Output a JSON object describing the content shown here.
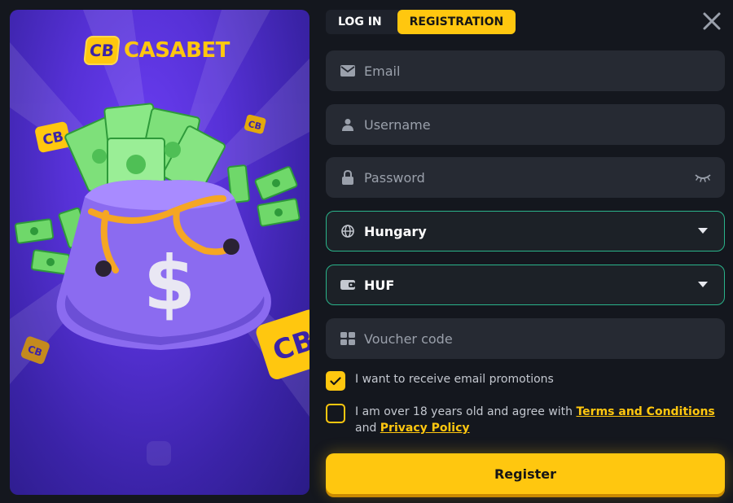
{
  "brand": {
    "logo_badge": "CB",
    "name_part1": "CASA",
    "name_part2": "BET"
  },
  "tabs": [
    {
      "label": "LOG IN",
      "active": false
    },
    {
      "label": "REGISTRATION",
      "active": true
    }
  ],
  "fields": {
    "email": {
      "placeholder": "Email",
      "icon": "envelope-icon"
    },
    "username": {
      "placeholder": "Username",
      "icon": "user-icon"
    },
    "password": {
      "placeholder": "Password",
      "icon": "lock-icon",
      "trailing_icon": "eye-closed-icon"
    },
    "country": {
      "value": "Hungary",
      "icon": "globe-icon",
      "trailing_icon": "caret-down-icon"
    },
    "currency": {
      "value": "HUF",
      "icon": "wallet-icon",
      "trailing_icon": "caret-down-icon"
    },
    "voucher": {
      "placeholder": "Voucher code",
      "icon": "ticket-icon"
    }
  },
  "checkboxes": {
    "promotions": {
      "label": "I want to receive email promotions",
      "checked": true
    },
    "terms": {
      "text_before": "I am over 18 years old and agree with ",
      "terms_link": "Terms and Conditions",
      "text_and": "and ",
      "privacy_link": "Privacy Policy",
      "checked": false
    }
  },
  "register_button": "Register",
  "colors": {
    "accent": "#ffc70f",
    "background": "#14171e",
    "field": "#262a33",
    "select_border": "#2ab38a",
    "promo_purple": "#5631d6"
  }
}
